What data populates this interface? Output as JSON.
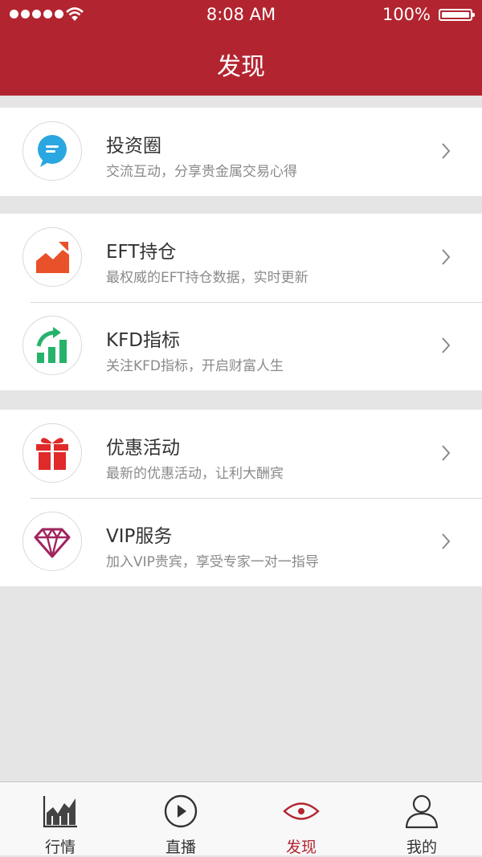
{
  "status_bar": {
    "time": "8:08 AM",
    "battery": "100%"
  },
  "header": {
    "title": "发现"
  },
  "items": [
    {
      "title": "投资圈",
      "subtitle": "交流互动，分享贵金属交易心得"
    },
    {
      "title": "EFT持仓",
      "subtitle": "最权威的EFT持仓数据，实时更新"
    },
    {
      "title": "KFD指标",
      "subtitle": "关注KFD指标，开启财富人生"
    },
    {
      "title": "优惠活动",
      "subtitle": "最新的优惠活动，让利大酬宾"
    },
    {
      "title": "VIP服务",
      "subtitle": "加入VIP贵宾，享受专家一对一指导"
    }
  ],
  "tabs": [
    {
      "label": "行情",
      "icon": "chart-icon"
    },
    {
      "label": "直播",
      "icon": "play-icon"
    },
    {
      "label": "发现",
      "icon": "eye-icon",
      "active": true
    },
    {
      "label": "我的",
      "icon": "user-icon"
    }
  ],
  "colors": {
    "brand": "#b22530",
    "chat": "#2aa6e0",
    "trend": "#e8512a",
    "growth": "#27b26b",
    "gift": "#e02a2a",
    "vip": "#a0245e"
  }
}
